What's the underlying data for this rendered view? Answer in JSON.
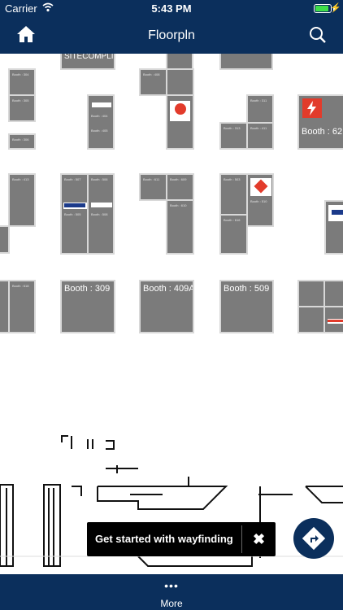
{
  "status_bar": {
    "carrier": "Carrier",
    "time": "5:43 PM",
    "battery_level": 0.9
  },
  "nav": {
    "title": "Floorpln"
  },
  "map": {
    "booth_labels": {
      "top_center": "SITECOMPLI",
      "b62": "Booth : 62",
      "b309": "Booth : 309",
      "b409a": "Booth : 409A",
      "b509": "Booth : 509"
    },
    "small_labels": {
      "s1": "Booth : 304",
      "s2": "Booth : 305",
      "s3": "Booth : 306",
      "s4": "Booth : 404",
      "s5": "Booth : 405",
      "s6": "Booth : 408",
      "s7": "Booth : 311",
      "s8": "Booth : 313",
      "s9": "Booth : 411",
      "s10": "Booth : 413",
      "s11": "Booth : 507",
      "s12": "Booth : 505",
      "s13": "Booth : 506",
      "s14": "Booth : 508",
      "s15": "Booth : 611",
      "s16": "Booth : 609",
      "s17": "Booth : 610",
      "s18": "Booth : 503",
      "s19": "Booth : 510",
      "s20": "Booth : 616",
      "s21": "Booth : 618"
    },
    "logo_names": [
      "sw24-logo",
      "lightning-logo",
      "varo-logo",
      "diamond-logo"
    ]
  },
  "toast": {
    "message": "Get started with wayfinding",
    "close": "✖"
  },
  "bottom": {
    "dots": "•••",
    "more_label": "More"
  },
  "colors": {
    "brand": "#0b2f5c",
    "booth": "#7b7b7b",
    "booth_border": "#d8d8d8",
    "highlight_red": "#e23b2b"
  }
}
